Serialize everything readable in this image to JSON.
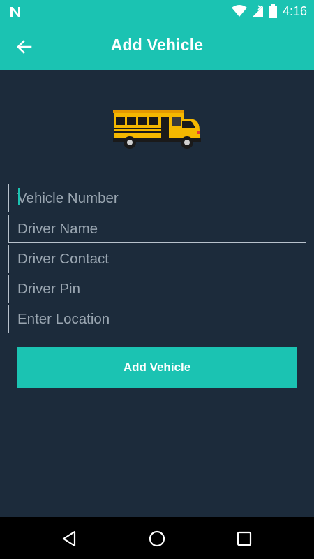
{
  "status_bar": {
    "time": "4:16",
    "icons": [
      "notification-n-icon",
      "wifi-icon",
      "signal-icon",
      "battery-icon"
    ]
  },
  "app_bar": {
    "title": "Add Vehicle",
    "back_icon": "arrow-back-icon"
  },
  "header_image": "school-bus-icon",
  "form": {
    "fields": [
      {
        "placeholder": "Vehicle Number",
        "value": ""
      },
      {
        "placeholder": "Driver Name",
        "value": ""
      },
      {
        "placeholder": "Driver Contact",
        "value": ""
      },
      {
        "placeholder": "Driver Pin",
        "value": ""
      },
      {
        "placeholder": "Enter Location",
        "value": ""
      }
    ],
    "submit_label": "Add Vehicle"
  },
  "nav_bar": {
    "buttons": [
      "back-triangle-icon",
      "home-circle-icon",
      "recents-square-icon"
    ]
  },
  "colors": {
    "accent": "#1bc3b2",
    "background": "#1c2b3b",
    "field_line": "#b8c2cc",
    "placeholder": "#9aa6b1"
  }
}
